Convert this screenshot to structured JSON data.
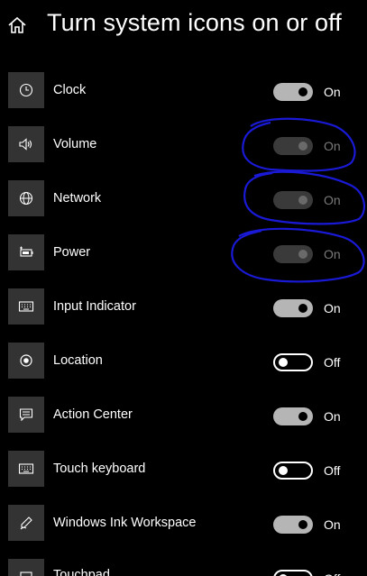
{
  "header": {
    "title": "Turn system icons on or off",
    "home_icon": "home-icon"
  },
  "rows": [
    {
      "label": "Clock",
      "icon": "clock-icon",
      "state": "On",
      "toggle": "on"
    },
    {
      "label": "Volume",
      "icon": "speaker-icon",
      "state": "On",
      "toggle": "disabled"
    },
    {
      "label": "Network",
      "icon": "globe-icon",
      "state": "On",
      "toggle": "disabled"
    },
    {
      "label": "Power",
      "icon": "battery-icon",
      "state": "On",
      "toggle": "disabled"
    },
    {
      "label": "Input Indicator",
      "icon": "keyboard-icon",
      "state": "On",
      "toggle": "on"
    },
    {
      "label": "Location",
      "icon": "location-icon",
      "state": "Off",
      "toggle": "off"
    },
    {
      "label": "Action Center",
      "icon": "message-icon",
      "state": "On",
      "toggle": "on"
    },
    {
      "label": "Touch keyboard",
      "icon": "keyboard-icon",
      "state": "Off",
      "toggle": "off"
    },
    {
      "label": "Windows Ink Workspace",
      "icon": "pen-icon",
      "state": "On",
      "toggle": "on"
    },
    {
      "label": "Touchpad",
      "icon": "touchpad-icon",
      "state": "Off",
      "toggle": "off"
    }
  ],
  "colors": {
    "background": "#000000",
    "icon_tile": "#333333",
    "toggle_on": "#b5b5b5",
    "toggle_disabled": "#3a3a3a",
    "annotation": "#1a1ad6"
  }
}
